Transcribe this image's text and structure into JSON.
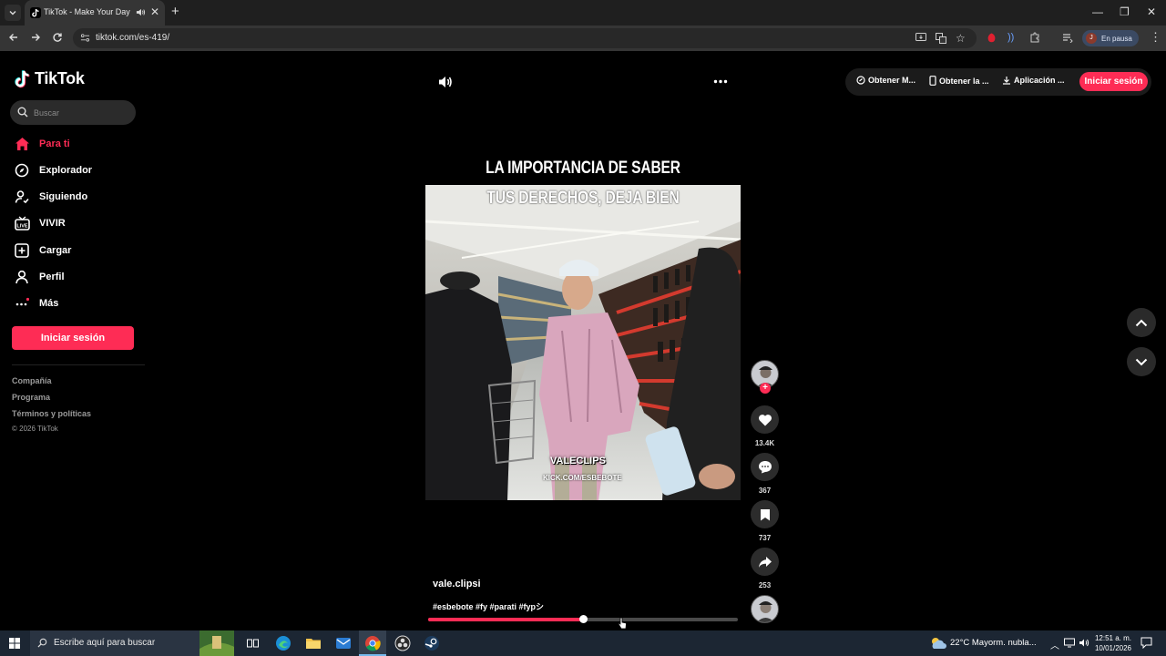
{
  "browser": {
    "tab_title": "TikTok - Make Your Day",
    "url": "tiktok.com/es-419/",
    "profile_initial": "J",
    "profile_status": "En pausa"
  },
  "sidebar": {
    "logo": "TikTok",
    "search_placeholder": "Buscar",
    "items": [
      {
        "label": "Para ti",
        "icon": "home-icon",
        "active": true
      },
      {
        "label": "Explorador",
        "icon": "compass-icon",
        "active": false
      },
      {
        "label": "Siguiendo",
        "icon": "following-icon",
        "active": false
      },
      {
        "label": "VIVIR",
        "icon": "live-icon",
        "active": false
      },
      {
        "label": "Cargar",
        "icon": "upload-icon",
        "active": false
      },
      {
        "label": "Perfil",
        "icon": "profile-icon",
        "active": false
      },
      {
        "label": "Más",
        "icon": "more-icon",
        "active": false
      }
    ],
    "login_button": "Iniciar sesión",
    "footer_links": [
      "Compañía",
      "Programa",
      "Términos y políticas"
    ],
    "copyright": "© 2026 TikTok"
  },
  "topbar": {
    "action_1": "Obtener M...",
    "action_2": "Obtener la ...",
    "action_3": "Aplicación ...",
    "login_button": "Iniciar sesión"
  },
  "video": {
    "caption_line_1": "LA IMPORTANCIA DE SABER",
    "caption_line_2": "TUS DERECHOS, DEJA BIEN",
    "watermark_1": "VALECLIPS",
    "watermark_2": "KICK.COM/ESBEBOTE",
    "author": "vale.clipsi",
    "description": "#esbebote #fy #parati #fypシ",
    "progress": 0.5
  },
  "actions": {
    "likes": "13.4K",
    "comments": "367",
    "saves": "737",
    "shares": "253"
  },
  "taskbar": {
    "search_placeholder": "Escribe aquí para buscar",
    "weather": "22°C  Mayorm. nubla...",
    "time": "12:51 a. m.",
    "date": "10/01/2026"
  },
  "colors": {
    "accent": "#fe2c55",
    "background": "#000000"
  }
}
